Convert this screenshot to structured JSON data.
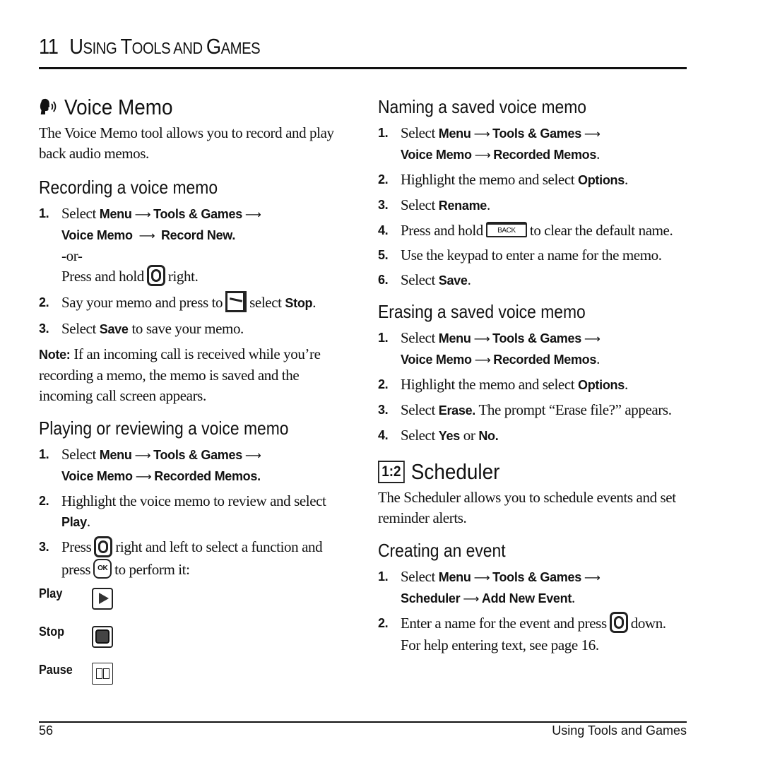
{
  "chapter": {
    "number": "11",
    "title_first": "U",
    "title_first_rest": "SING ",
    "title_t": "T",
    "title_t_rest": "OOLS AND ",
    "title_g": "G",
    "title_g_rest": "AMES"
  },
  "voice_memo": {
    "icon": "voice-speaking-icon",
    "title": "Voice Memo",
    "intro": "The Voice Memo tool allows you to record and play back audio memos.",
    "recording": {
      "heading": "Recording a voice memo",
      "steps": [
        {
          "n": "1.",
          "pre": "Select ",
          "menu": "Menu",
          "tools": "Tools & Games",
          "voice": "Voice Memo",
          "target": "Record New.",
          "or": "-or-",
          "alt_pre": "Press and hold",
          "alt_post": "right."
        },
        {
          "n": "2.",
          "pre": "Say your memo and press to",
          "post": "select ",
          "bold": "Stop",
          "end": "."
        },
        {
          "n": "3.",
          "pre": "Select ",
          "bold": "Save",
          "post": " to save your memo."
        }
      ],
      "note_label": "Note:",
      "note_text": " If an incoming call is received while you’re recording a memo, the memo is saved and the incoming call screen appears."
    },
    "playing": {
      "heading": "Playing or reviewing a voice memo",
      "steps": [
        {
          "n": "1.",
          "pre": "Select ",
          "menu": "Menu",
          "tools": "Tools & Games",
          "voice": "Voice Memo",
          "target": "Recorded Memos."
        },
        {
          "n": "2.",
          "pre": "Highlight the voice memo to review and select ",
          "bold": "Play",
          "end": "."
        },
        {
          "n": "3.",
          "pre": "Press",
          "mid": "right and left to select a function and press",
          "ok": "OK",
          "post": "to perform it:"
        }
      ],
      "functions": [
        {
          "label": "Play",
          "icon": "play-icon"
        },
        {
          "label": "Stop",
          "icon": "stop-icon"
        },
        {
          "label": "Pause",
          "icon": "pause-icon"
        }
      ]
    }
  },
  "naming": {
    "heading": "Naming a saved voice memo",
    "steps": [
      {
        "n": "1.",
        "pre": "Select ",
        "menu": "Menu",
        "tools": "Tools & Games",
        "voice": "Voice Memo",
        "target": "Recorded Memos",
        "end": "."
      },
      {
        "n": "2.",
        "pre": "Highlight the memo and select ",
        "bold": "Options",
        "end": "."
      },
      {
        "n": "3.",
        "pre": "Select ",
        "bold": "Rename",
        "end": "."
      },
      {
        "n": "4.",
        "pre": "Press and hold",
        "key": "BACK",
        "post": "to clear the default name."
      },
      {
        "n": "5.",
        "pre": "Use the keypad to enter a name for the memo."
      },
      {
        "n": "6.",
        "pre": "Select ",
        "bold": "Save",
        "end": "."
      }
    ]
  },
  "erasing": {
    "heading": "Erasing a saved voice memo",
    "steps": [
      {
        "n": "1.",
        "pre": "Select ",
        "menu": "Menu",
        "tools": "Tools & Games",
        "voice": "Voice Memo",
        "target": "Recorded Memos",
        "end": "."
      },
      {
        "n": "2.",
        "pre": "Highlight the memo and select ",
        "bold": "Options",
        "end": "."
      },
      {
        "n": "3.",
        "pre": "Select ",
        "bold": "Erase.",
        "post": " The prompt “Erase file?” appears."
      },
      {
        "n": "4.",
        "pre": "Select ",
        "bold": "Yes",
        "mid": " or ",
        "bold2": "No."
      }
    ]
  },
  "scheduler": {
    "icon": "scheduler-icon",
    "icon_text": "1:2",
    "title": "Scheduler",
    "intro": "The Scheduler allows you to schedule events and set reminder alerts.",
    "creating": {
      "heading": "Creating an event",
      "steps": [
        {
          "n": "1.",
          "pre": "Select ",
          "menu": "Menu",
          "tools": "Tools & Games",
          "sched": "Scheduler",
          "target": "Add New Event",
          "end": "."
        },
        {
          "n": "2.",
          "pre": "Enter a name for the event and press",
          "post": "down. For help entering text, see page 16."
        }
      ]
    }
  },
  "arrow": "⟶",
  "footer": {
    "page": "56",
    "title": "Using Tools and Games"
  }
}
